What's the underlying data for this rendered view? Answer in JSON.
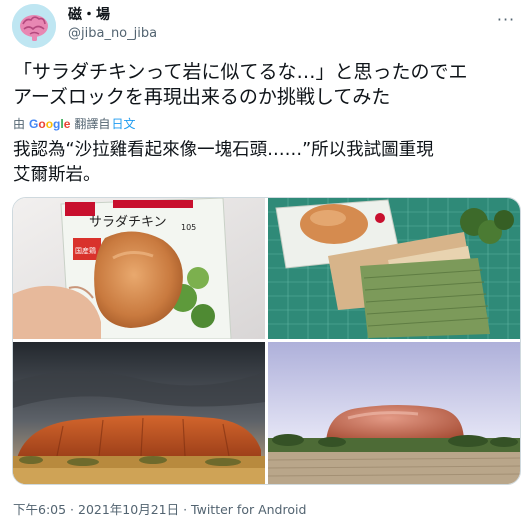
{
  "author": {
    "display_name": "磁・場",
    "handle": "@jiba_no_jiba",
    "avatar_icon": "brain-avatar-icon"
  },
  "more_button": {
    "icon": "more-horizontal-icon",
    "label": "···"
  },
  "tweet": {
    "text_line_1": "「サラダチキンって岩に似てるな…」と思ったのでエ",
    "text_line_2": "アーズロックを再現出来るのか挑戦してみた"
  },
  "translation": {
    "prefix": "由",
    "provider": "Google",
    "label": "翻譯自",
    "source_language": "日文",
    "text_line_1": "我認為“沙拉雞看起來像一塊石頭……”所以我試圖重現",
    "text_line_2": "艾爾斯岩。"
  },
  "media": {
    "photo_1": {
      "kind": "salad-chicken-package-photo",
      "package_text": "サラダチキン",
      "weight_text": "105",
      "badge_text": "国産鶏"
    },
    "photo_2": {
      "kind": "crafting-materials-photo"
    },
    "photo_3": {
      "kind": "uluru-photo"
    },
    "photo_4": {
      "kind": "chicken-uluru-recreation-photo"
    }
  },
  "footer": {
    "time": "下午6:05",
    "separator_1": " · ",
    "date": "2021年10月21日",
    "separator_2": " · ",
    "source": "Twitter for Android"
  },
  "colors": {
    "text": "#0f1419",
    "secondary": "#536471",
    "link": "#1d9bf0",
    "border": "#cfd9de"
  }
}
